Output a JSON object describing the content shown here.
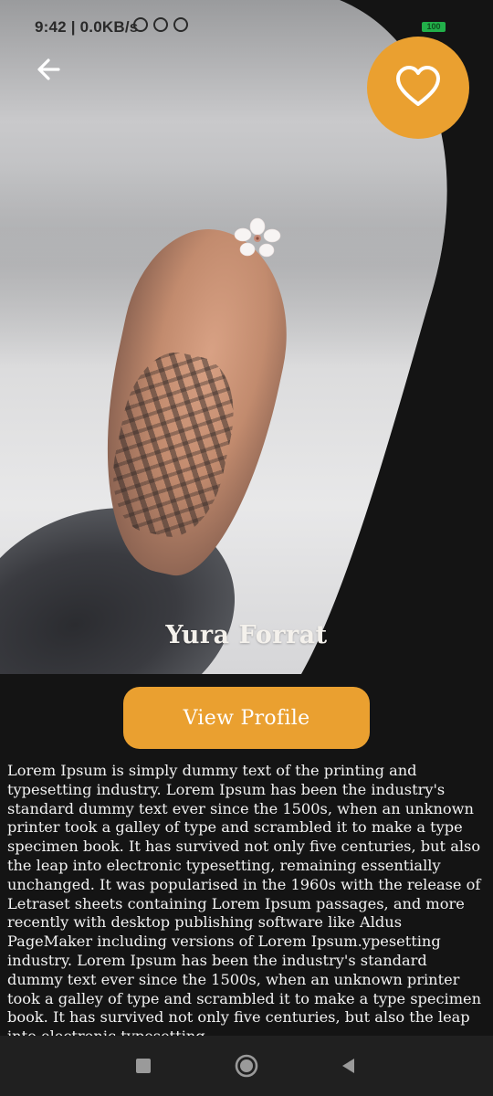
{
  "status_bar": {
    "time": "9:42",
    "network_speed": "0.0KB/s",
    "battery": "100",
    "icons": [
      "alarm-icon",
      "sync-icon",
      "vpn-icon",
      "signal-icon",
      "battery-icon"
    ]
  },
  "header": {
    "back_icon": "arrow-left-icon",
    "favorite_icon": "heart-outline-icon"
  },
  "profile": {
    "name": "Yura Forrat",
    "view_profile_label": "View Profile",
    "description": "Lorem Ipsum is simply dummy text of the printing and typesetting industry. Lorem Ipsum has been the industry's standard dummy text ever since the 1500s, when an unknown printer took a galley of type and scrambled it to make a type specimen book. It has survived not only five centuries, but also the leap into electronic typesetting, remaining essentially unchanged. It was popularised in the 1960s with the release of Letraset sheets containing Lorem Ipsum passages, and more recently with desktop publishing software like Aldus PageMaker including versions of Lorem Ipsum.ypesetting industry. Lorem Ipsum has been the industry's standard dummy text ever since the 1500s, when an unknown printer took a galley of type and scrambled it to make a type specimen book. It has survived not only five centuries, but also the leap into electronic typesetting"
  },
  "nav_bar": {
    "items": [
      "recents-square-icon",
      "home-circle-icon",
      "back-triangle-icon"
    ]
  },
  "colors": {
    "accent": "#eaa030",
    "background": "#141414",
    "text": "#f2f2f2",
    "nav_background": "#202020"
  }
}
